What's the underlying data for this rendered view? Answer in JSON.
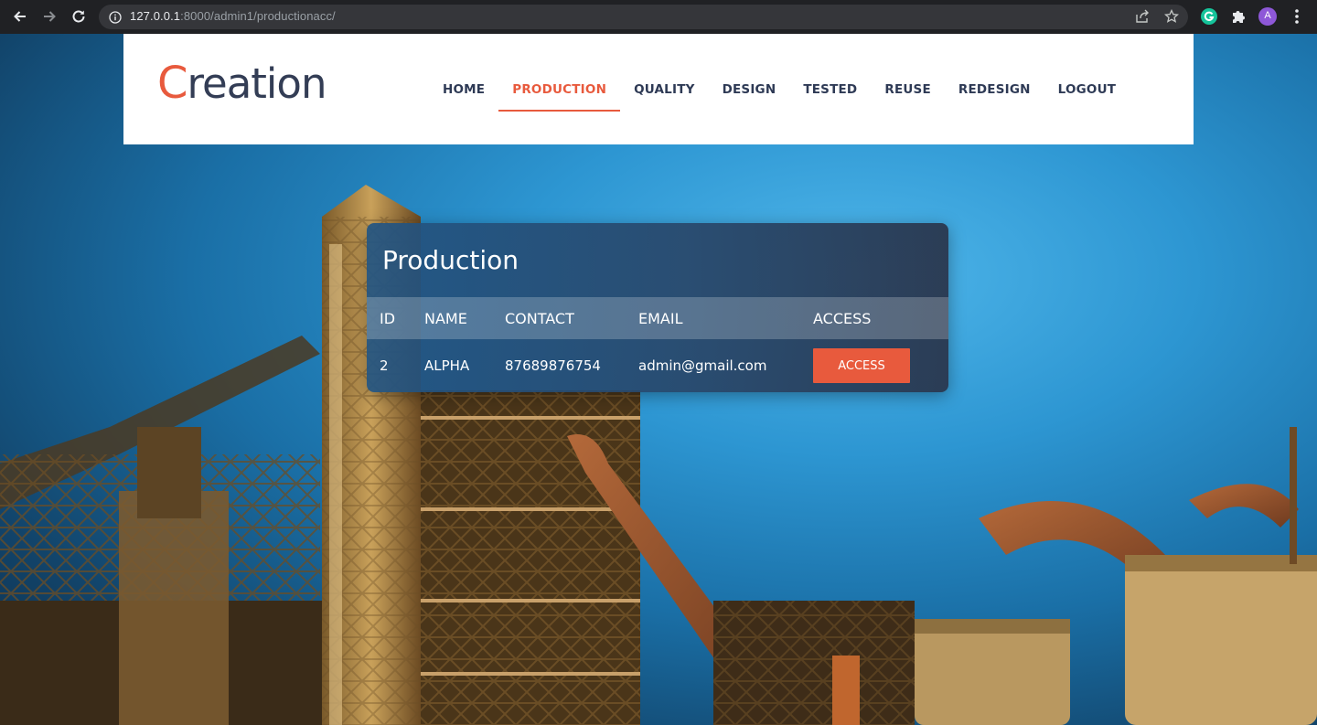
{
  "browser": {
    "url_host": "127.0.0.1",
    "url_rest": ":8000/admin1/productionacc/",
    "profile_initial": "A",
    "icons": [
      "back-arrow-icon",
      "forward-arrow-icon",
      "reload-icon",
      "info-icon",
      "share-icon",
      "star-icon",
      "grammarly-icon",
      "extensions-icon",
      "profile-icon",
      "kebab-menu-icon"
    ]
  },
  "header": {
    "logo_first": "C",
    "logo_rest": "reation",
    "nav": [
      "HOME",
      "PRODUCTION",
      "QUALITY",
      "DESIGN",
      "TESTED",
      "REUSE",
      "REDESIGN",
      "LOGOUT"
    ],
    "active": "PRODUCTION"
  },
  "card": {
    "title": "Production",
    "columns": [
      "ID",
      "NAME",
      "CONTACT",
      "EMAIL",
      "ACCESS"
    ],
    "rows": [
      {
        "id": "2",
        "name": "ALPHA",
        "contact": "87689876754",
        "email": "admin@gmail.com",
        "action": "ACCESS"
      }
    ]
  },
  "colors": {
    "accent": "#e85a3d",
    "nav_text": "#2e3a55",
    "chrome_bg": "#202124"
  }
}
